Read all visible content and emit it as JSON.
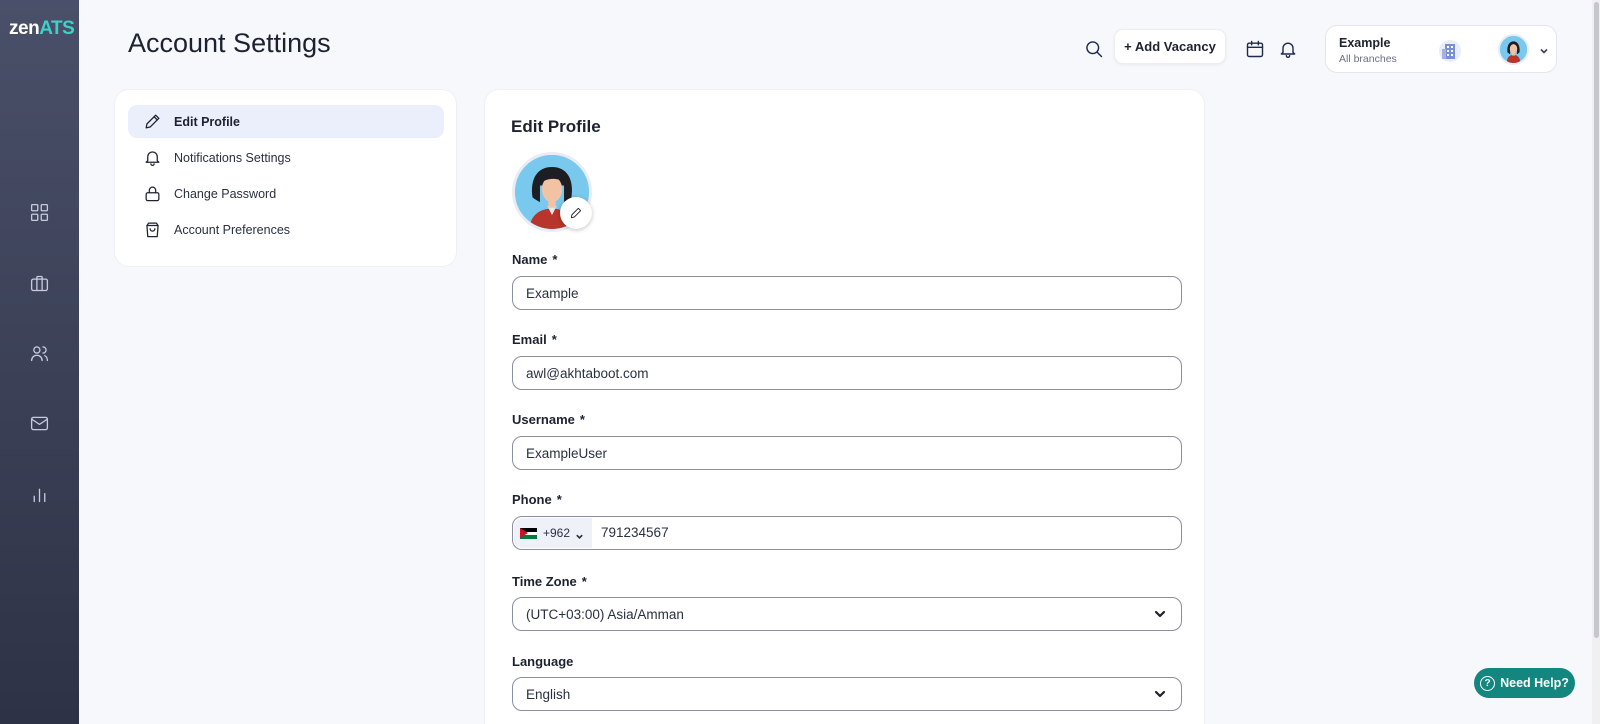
{
  "app": {
    "logo_part1": "zen",
    "logo_part2": "ATS"
  },
  "header": {
    "page_title": "Account Settings",
    "add_vacancy_label": "+ Add Vacancy",
    "user_name": "Example",
    "user_branch": "All branches"
  },
  "rail": {
    "icons": [
      "dashboard-icon",
      "briefcase-icon",
      "users-icon",
      "mail-icon",
      "chart-icon"
    ]
  },
  "settings_menu": {
    "items": [
      {
        "label": "Edit Profile",
        "icon": "pencil-icon",
        "active": true
      },
      {
        "label": "Notifications Settings",
        "icon": "bell-icon",
        "active": false
      },
      {
        "label": "Change Password",
        "icon": "lock-icon",
        "active": false
      },
      {
        "label": "Account Preferences",
        "icon": "shopping-bag-icon",
        "active": false
      }
    ]
  },
  "form": {
    "title": "Edit Profile",
    "required_marker": "*",
    "name": {
      "label": "Name",
      "value": "Example"
    },
    "email": {
      "label": "Email",
      "value": "awl@akhtaboot.com"
    },
    "username": {
      "label": "Username",
      "value": "ExampleUser"
    },
    "phone": {
      "label": "Phone",
      "dial_code": "+962",
      "country_flag": "jordan-flag",
      "value": "791234567"
    },
    "timezone": {
      "label": "Time Zone",
      "value": "(UTC+03:00) Asia/Amman"
    },
    "language": {
      "label": "Language",
      "value": "English"
    }
  },
  "help": {
    "label": "Need Help?",
    "icon_glyph": "?"
  },
  "colors": {
    "accent_teal": "#13877f",
    "logo_teal": "#3fd0c8",
    "active_menu_bg": "#ebeffb",
    "rail_dark": "#2e3246"
  }
}
